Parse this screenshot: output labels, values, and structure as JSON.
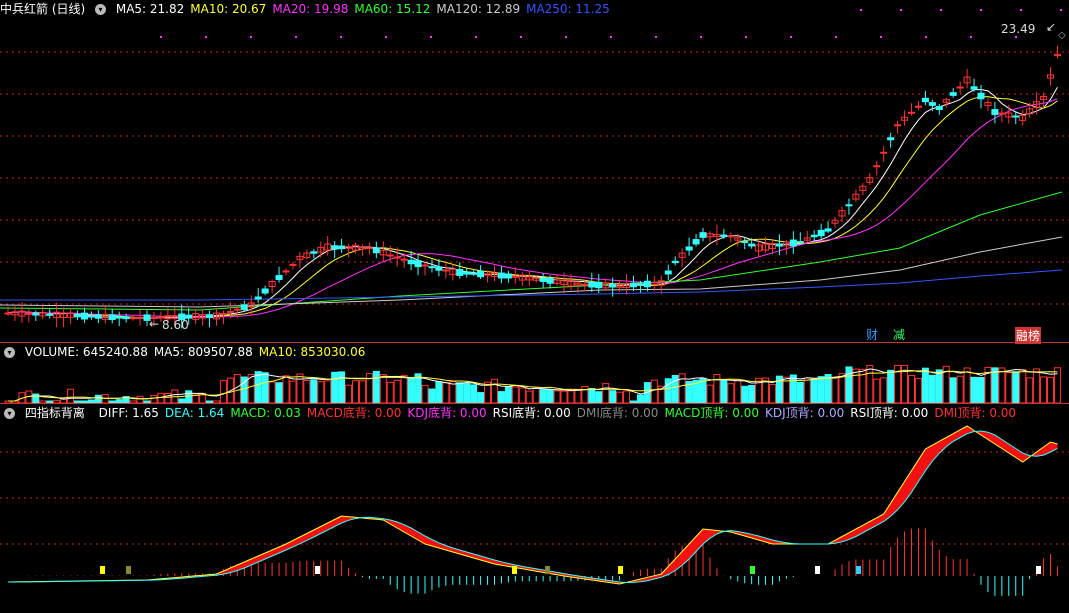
{
  "main": {
    "title": "中兵红箭 (日线)",
    "ma": [
      {
        "label": "MA5: 21.82",
        "color": "#ffffff"
      },
      {
        "label": "MA10: 20.67",
        "color": "#ffff33"
      },
      {
        "label": "MA20: 19.98",
        "color": "#ff33ff"
      },
      {
        "label": "MA60: 15.12",
        "color": "#33ff33"
      },
      {
        "label": "MA120: 12.89",
        "color": "#cccccc"
      },
      {
        "label": "MA250: 11.25",
        "color": "#3355ff"
      }
    ],
    "high_label": "23.49",
    "low_label": "8.60",
    "tags": [
      {
        "text": "财",
        "color": "#3399ff"
      },
      {
        "text": "减",
        "color": "#33ff66"
      },
      {
        "text": "融",
        "color": "#ffffff",
        "bg": "#cc3333"
      },
      {
        "text": "榜",
        "color": "#ffffff",
        "bg": "#cc3333"
      }
    ]
  },
  "volume": {
    "labels": [
      {
        "text": "VOLUME: 645240.88",
        "color": "#ffffff"
      },
      {
        "text": "MA5: 809507.88",
        "color": "#ffffff"
      },
      {
        "text": "MA10: 853030.06",
        "color": "#ffff33"
      }
    ]
  },
  "indicator": {
    "title": "四指标背离",
    "labels": [
      {
        "text": "DIFF: 1.65",
        "color": "#ffffff"
      },
      {
        "text": "DEA: 1.64",
        "color": "#33ffff"
      },
      {
        "text": "MACD: 0.03",
        "color": "#33ff33"
      },
      {
        "text": "MACD底背: 0.00",
        "color": "#ff3333"
      },
      {
        "text": "KDJ底背: 0.00",
        "color": "#ff33ff"
      },
      {
        "text": "RSI底背: 0.00",
        "color": "#ffffff"
      },
      {
        "text": "DMI底背: 0.00",
        "color": "#888888"
      },
      {
        "text": "MACD顶背: 0.00",
        "color": "#33ff33"
      },
      {
        "text": "KDJ顶背: 0.00",
        "color": "#aaaaff"
      },
      {
        "text": "RSI顶背: 0.00",
        "color": "#ffffff"
      },
      {
        "text": "DMI顶背: 0.00",
        "color": "#ff3333"
      }
    ]
  },
  "colors": {
    "up": "#ff3333",
    "down": "#33ffff",
    "grid": "#cc2222"
  }
}
